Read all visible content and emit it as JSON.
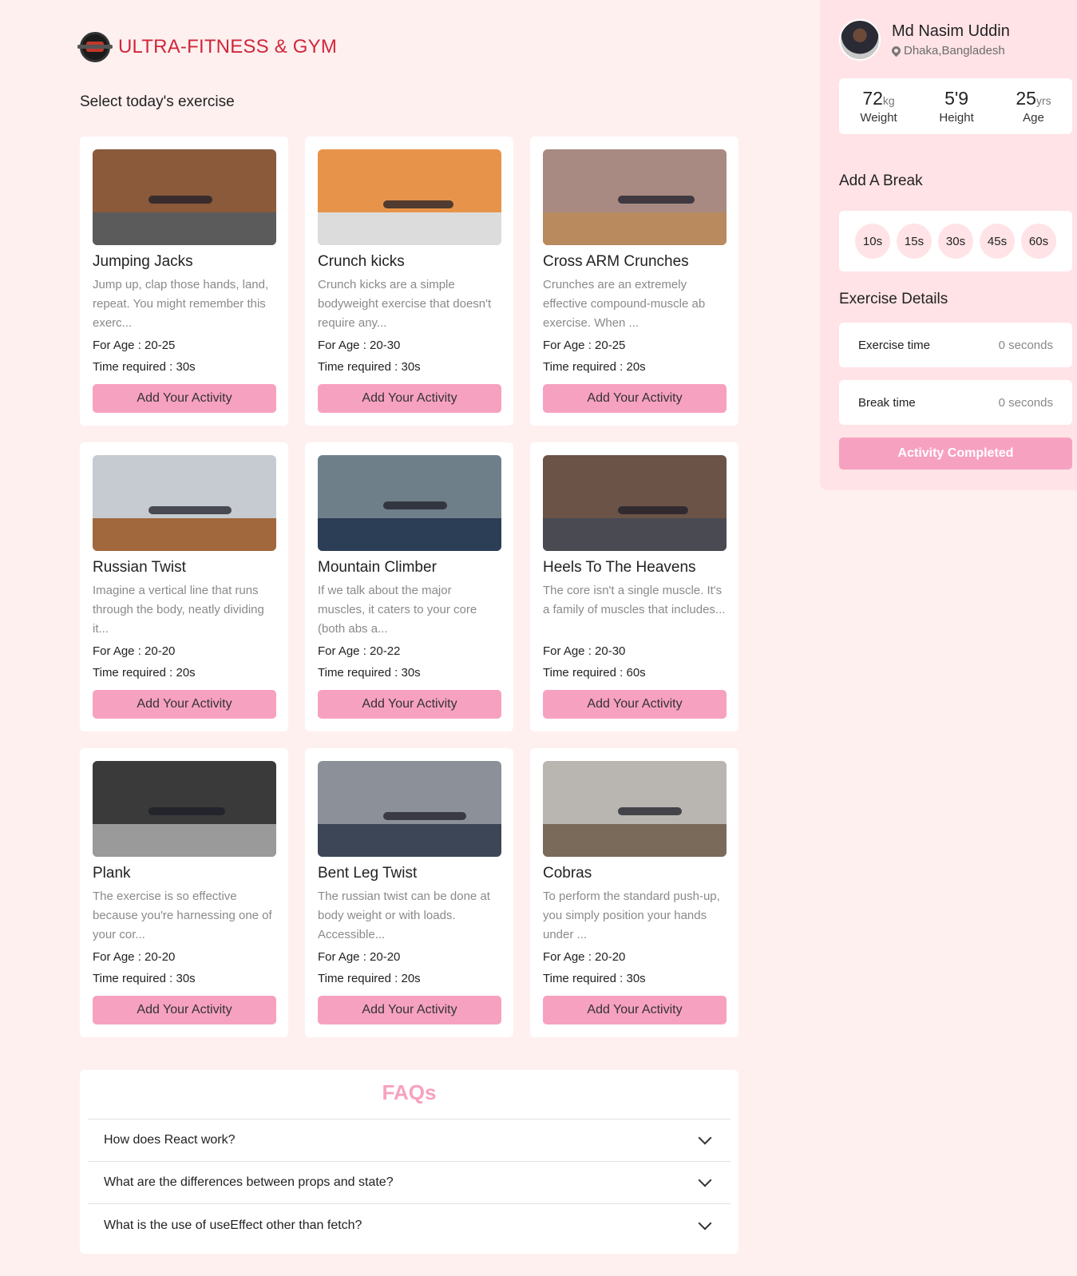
{
  "brand": {
    "title": "ULTRA-FITNESS & GYM"
  },
  "main": {
    "section_title": "Select today's exercise",
    "cards": [
      {
        "title": "Jumping Jacks",
        "desc": "Jump up, clap those hands, land, repeat. You might remember this exerc...",
        "age": "For Age : 20-25",
        "time": "Time required : 30s",
        "button": "Add Your Activity",
        "img_bg": "#8a5a3b",
        "img_floor": "#5b5b5b"
      },
      {
        "title": "Crunch kicks",
        "desc": "Crunch kicks are a simple bodyweight exercise that doesn't require any...",
        "age": "For Age : 20-30",
        "time": "Time required : 30s",
        "button": "Add Your Activity",
        "img_bg": "#e8934a",
        "img_floor": "#dcdcdc"
      },
      {
        "title": "Cross ARM Crunches",
        "desc": "Crunches are an extremely effective compound-muscle ab exercise. When ...",
        "age": "For Age : 20-25",
        "time": "Time required : 20s",
        "button": "Add Your Activity",
        "img_bg": "#a88a82",
        "img_floor": "#b88a5e"
      },
      {
        "title": "Russian Twist",
        "desc": "Imagine a vertical line that runs through the body, neatly dividing it...",
        "age": "For Age : 20-20",
        "time": "Time required : 20s",
        "button": "Add Your Activity",
        "img_bg": "#c5cbd1",
        "img_floor": "#a0683c"
      },
      {
        "title": "Mountain Climber",
        "desc": "If we talk about the major muscles, it caters to your core (both abs a...",
        "age": "For Age : 20-22",
        "time": "Time required : 30s",
        "button": "Add Your Activity",
        "img_bg": "#6f7f8a",
        "img_floor": "#2c3e55"
      },
      {
        "title": "Heels To The Heavens",
        "desc": "The core isn't a single muscle. It's a family of muscles that includes...",
        "age": "For Age : 20-30",
        "time": "Time required : 60s",
        "button": "Add Your Activity",
        "img_bg": "#6b5447",
        "img_floor": "#4a4a52"
      },
      {
        "title": "Plank",
        "desc": "The exercise is so effective because you're harnessing one of your cor...",
        "age": "For Age : 20-20",
        "time": "Time required : 30s",
        "button": "Add Your Activity",
        "img_bg": "#3a3a3a",
        "img_floor": "#9a9a9a"
      },
      {
        "title": "Bent Leg Twist",
        "desc": "The russian twist can be done at body weight or with loads. Accessible...",
        "age": "For Age : 20-20",
        "time": "Time required : 20s",
        "button": "Add Your Activity",
        "img_bg": "#8b9099",
        "img_floor": "#3d4656"
      },
      {
        "title": "Cobras",
        "desc": "To perform the standard push-up, you simply position your hands under ...",
        "age": "For Age : 20-20",
        "time": "Time required : 30s",
        "button": "Add Your Activity",
        "img_bg": "#b9b5b0",
        "img_floor": "#7a6a5a"
      }
    ]
  },
  "faq": {
    "title": "FAQs",
    "items": [
      {
        "question": "How does React work?"
      },
      {
        "question": "What are the differences between props and state?"
      },
      {
        "question": "What is the use of useEffect other than fetch?"
      }
    ]
  },
  "sidebar": {
    "user_name": "Md Nasim Uddin",
    "location": "Dhaka,Bangladesh",
    "stats": {
      "weight": {
        "value": "72",
        "unit": "kg",
        "label": "Weight"
      },
      "height": {
        "value": "5'9",
        "unit": "",
        "label": "Height"
      },
      "age": {
        "value": "25",
        "unit": "yrs",
        "label": "Age"
      }
    },
    "break_heading": "Add A Break",
    "breaks": [
      "10s",
      "15s",
      "30s",
      "45s",
      "60s"
    ],
    "details_heading": "Exercise Details",
    "exercise_time": {
      "label": "Exercise time",
      "value": "0 seconds"
    },
    "break_time": {
      "label": "Break time",
      "value": "0 seconds"
    },
    "complete_button": "Activity Completed"
  },
  "colors": {
    "accent_pink": "#f7a1c0",
    "brand_red": "#d0273a",
    "page_bg": "#fff0f0",
    "sidebar_bg": "#ffe3e6"
  },
  "icons": {
    "logo": "gym-logo-icon",
    "location": "map-pin-icon",
    "faq_toggle": "chevron-down-icon"
  }
}
